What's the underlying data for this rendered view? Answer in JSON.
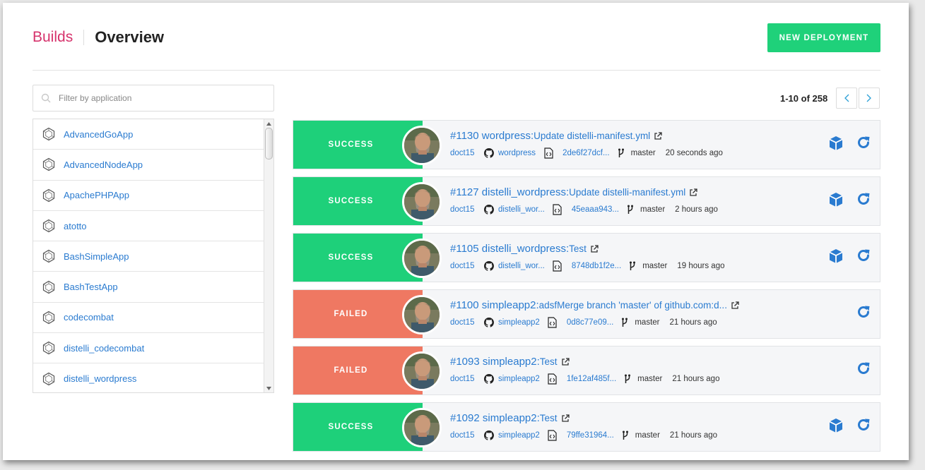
{
  "header": {
    "breadcrumb_builds": "Builds",
    "breadcrumb_overview": "Overview",
    "new_deployment": "NEW DEPLOYMENT"
  },
  "filter": {
    "placeholder": "Filter by application"
  },
  "apps": [
    {
      "label": "AdvancedGoApp"
    },
    {
      "label": "AdvancedNodeApp"
    },
    {
      "label": "ApachePHPApp"
    },
    {
      "label": "atotto"
    },
    {
      "label": "BashSimpleApp"
    },
    {
      "label": "BashTestApp"
    },
    {
      "label": "codecombat"
    },
    {
      "label": "distelli_codecombat"
    },
    {
      "label": "distelli_wordpress"
    }
  ],
  "pager": {
    "range": "1-10 of 258"
  },
  "colors": {
    "success": "#1ed07a",
    "failed": "#ef7862",
    "link": "#2a7bd0",
    "brand": "#d6336c"
  },
  "builds": [
    {
      "status": "SUCCESS",
      "num": "#1130 wordpress:",
      "msg": " Update distelli-manifest.yml",
      "user": "doct15",
      "repo": "wordpress",
      "sha": "2de6f27dcf...",
      "branch": "master",
      "time": "20 seconds ago",
      "deploy": true
    },
    {
      "status": "SUCCESS",
      "num": "#1127 distelli_wordpress:",
      "msg": " Update distelli-manifest.yml",
      "user": "doct15",
      "repo": "distelli_wor...",
      "sha": "45eaaa943...",
      "branch": "master",
      "time": "2 hours ago",
      "deploy": true
    },
    {
      "status": "SUCCESS",
      "num": "#1105 distelli_wordpress:",
      "msg": " Test",
      "user": "doct15",
      "repo": "distelli_wor...",
      "sha": "8748db1f2e...",
      "branch": "master",
      "time": "19 hours ago",
      "deploy": true
    },
    {
      "status": "FAILED",
      "num": "#1100 simpleapp2:",
      "msg": " adsfMerge branch 'master' of github.com:d...",
      "user": "doct15",
      "repo": "simpleapp2",
      "sha": "0d8c77e09...",
      "branch": "master",
      "time": "21 hours ago",
      "deploy": false
    },
    {
      "status": "FAILED",
      "num": "#1093 simpleapp2:",
      "msg": " Test",
      "user": "doct15",
      "repo": "simpleapp2",
      "sha": "1fe12af485f...",
      "branch": "master",
      "time": "21 hours ago",
      "deploy": false
    },
    {
      "status": "SUCCESS",
      "num": "#1092 simpleapp2:",
      "msg": " Test",
      "user": "doct15",
      "repo": "simpleapp2",
      "sha": "79ffe31964...",
      "branch": "master",
      "time": "21 hours ago",
      "deploy": true
    }
  ]
}
